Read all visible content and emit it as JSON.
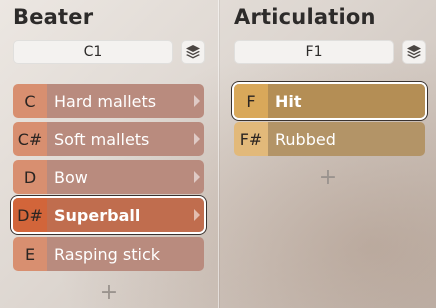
{
  "beater": {
    "title": "Beater",
    "selector_value": "C1",
    "layers_icon": "layers-icon",
    "rows": [
      {
        "note": "C",
        "label": "Hard mallets",
        "selected": false
      },
      {
        "note": "C#",
        "label": "Soft mallets",
        "selected": false
      },
      {
        "note": "D",
        "label": "Bow",
        "selected": false
      },
      {
        "note": "D#",
        "label": "Superball",
        "selected": true
      },
      {
        "note": "E",
        "label": "Rasping stick",
        "selected": false
      }
    ],
    "add_symbol": "+"
  },
  "articulation": {
    "title": "Articulation",
    "selector_value": "F1",
    "layers_icon": "layers-icon",
    "rows": [
      {
        "note": "F",
        "label": "Hit",
        "selected": true
      },
      {
        "note": "F#",
        "label": "Rubbed",
        "selected": false
      }
    ],
    "add_symbol": "+"
  },
  "colors": {
    "beater_note": "#d88f70",
    "beater_selected": "#d2653a",
    "articulation_note": "#e2b97a",
    "text_dark": "#2d2b2a"
  }
}
